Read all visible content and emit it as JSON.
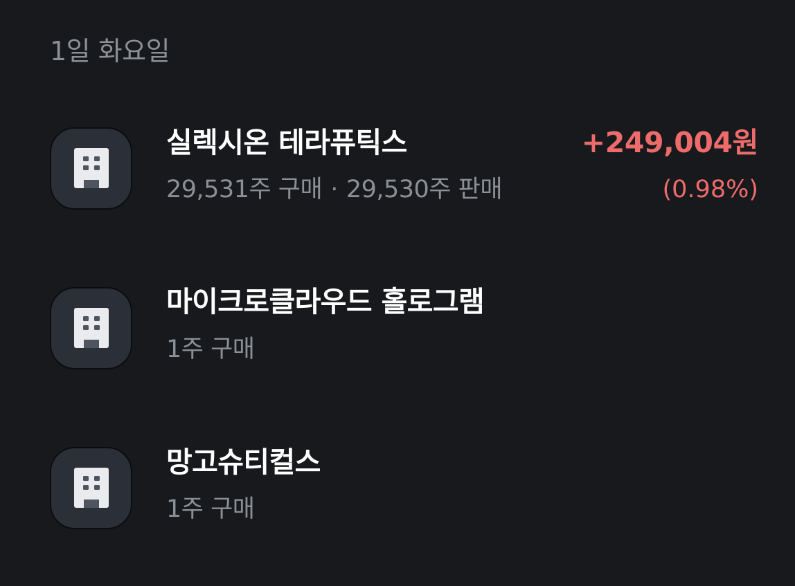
{
  "date_header": "1일 화요일",
  "transactions": [
    {
      "name": "실렉시온 테라퓨틱스",
      "buy": "29,531주 구매",
      "separator": "·",
      "sell": "29,530주 판매",
      "amount": "+249,004원",
      "rate": "(0.98%)",
      "icon": "building-icon",
      "amount_color": "#ee6b6b"
    },
    {
      "name": "마이크로클라우드 홀로그램",
      "buy": "1주 구매",
      "icon": "building-icon"
    },
    {
      "name": "망고슈티컬스",
      "buy": "1주 구매",
      "icon": "building-icon"
    }
  ]
}
